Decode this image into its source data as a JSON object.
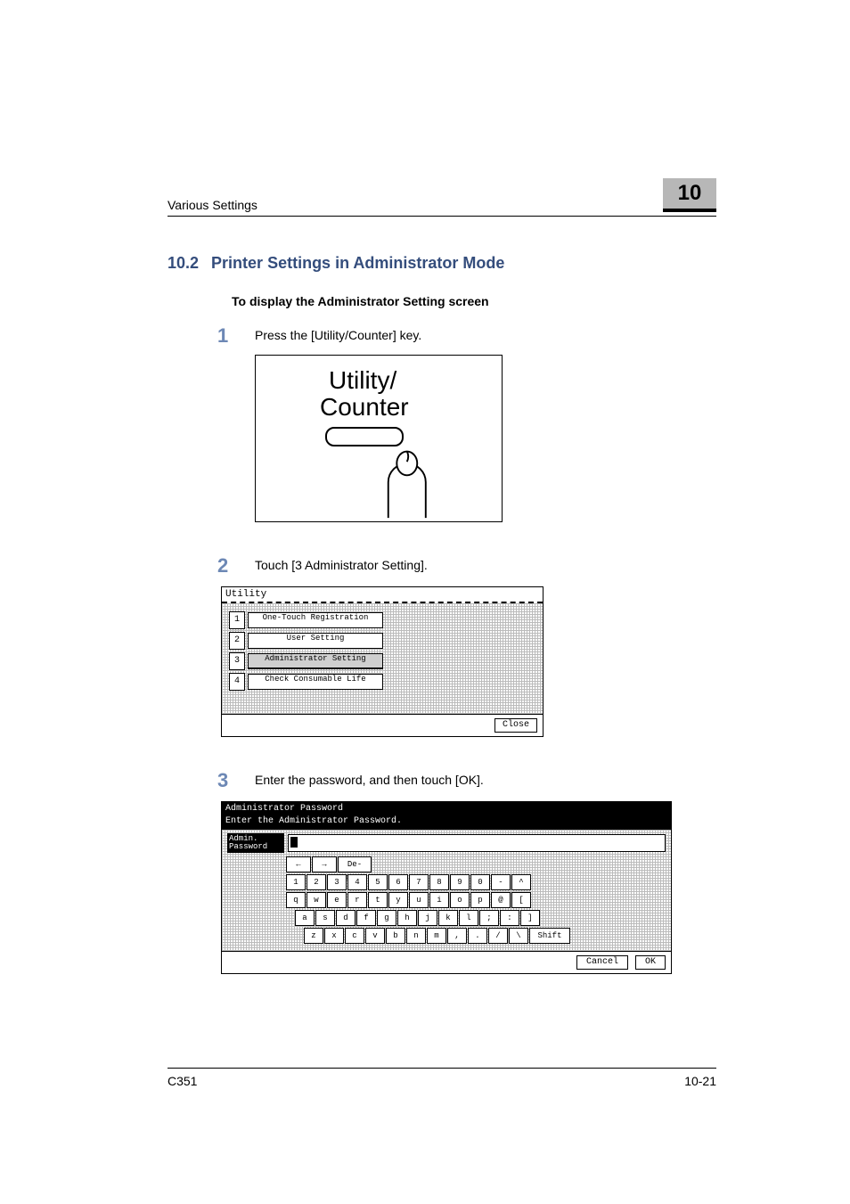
{
  "header": {
    "running_head": "Various Settings",
    "chapter_number": "10"
  },
  "section": {
    "number": "10.2",
    "title": "Printer Settings in Administrator Mode"
  },
  "subheading": "To display the Administrator Setting screen",
  "steps": {
    "s1": {
      "num": "1",
      "text": "Press the [Utility/Counter] key."
    },
    "s2": {
      "num": "2",
      "text": "Touch [3 Administrator Setting]."
    },
    "s3": {
      "num": "3",
      "text": "Enter the password, and then touch [OK]."
    }
  },
  "illus": {
    "title1": "Utility/",
    "title2": "Counter"
  },
  "screenshot_utility": {
    "title": "Utility",
    "items": [
      {
        "num": "1",
        "label": "One-Touch Registration"
      },
      {
        "num": "2",
        "label": "User Setting"
      },
      {
        "num": "3",
        "label": "Administrator Setting"
      },
      {
        "num": "4",
        "label": "Check Consumable Life"
      }
    ],
    "close": "Close"
  },
  "screenshot_password": {
    "head1": "Administrator Password",
    "head2": "Enter the Administrator Password.",
    "field_label": "Admin. Password",
    "delete_key": "De- lete",
    "row_nums": [
      "1",
      "2",
      "3",
      "4",
      "5",
      "6",
      "7",
      "8",
      "9",
      "0",
      "-",
      "^"
    ],
    "row_q": [
      "q",
      "w",
      "e",
      "r",
      "t",
      "y",
      "u",
      "i",
      "o",
      "p",
      "@",
      "["
    ],
    "row_a": [
      "a",
      "s",
      "d",
      "f",
      "g",
      "h",
      "j",
      "k",
      "l",
      ";",
      ":",
      "]"
    ],
    "row_z": [
      "z",
      "x",
      "c",
      "v",
      "b",
      "n",
      "m",
      ",",
      ".",
      "/",
      "\\"
    ],
    "shift": "Shift",
    "cancel": "Cancel",
    "ok": "OK"
  },
  "footer": {
    "model": "C351",
    "pagefolio": "10-21"
  }
}
